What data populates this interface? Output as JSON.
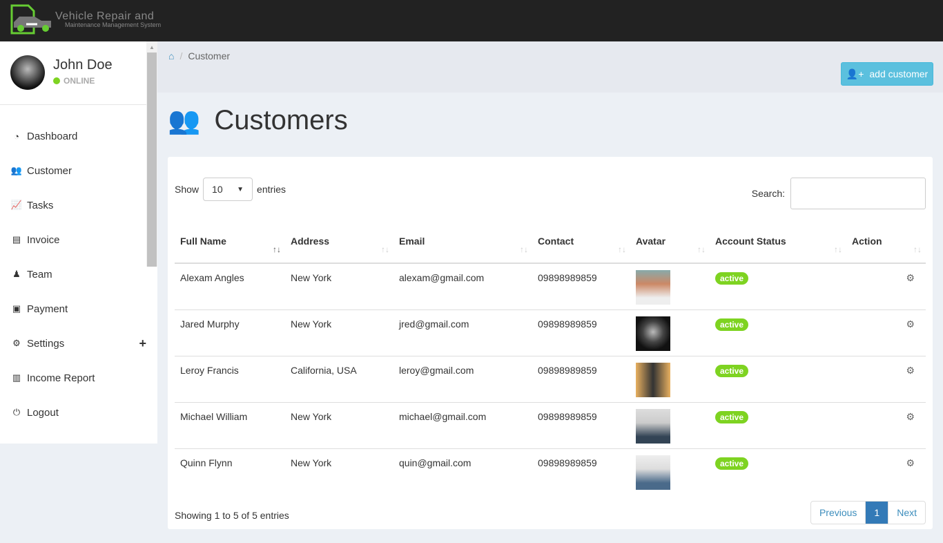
{
  "app": {
    "logo_line1": "Vehicle Repair and",
    "logo_line2": "Maintenance Management System"
  },
  "user": {
    "name": "John Doe",
    "status": "ONLINE"
  },
  "nav": [
    {
      "label": "Dashboard",
      "icon": "dashboard-icon",
      "glyph": "◔"
    },
    {
      "label": "Customer",
      "icon": "users-icon",
      "glyph": "👥"
    },
    {
      "label": "Tasks",
      "icon": "line-chart-icon",
      "glyph": "📈"
    },
    {
      "label": "Invoice",
      "icon": "file-icon",
      "glyph": "▤"
    },
    {
      "label": "Team",
      "icon": "user-secret-icon",
      "glyph": "♟"
    },
    {
      "label": "Payment",
      "icon": "money-icon",
      "glyph": "▣"
    },
    {
      "label": "Settings",
      "icon": "gears-icon",
      "glyph": "⚙"
    },
    {
      "label": "Income Report",
      "icon": "bar-chart-icon",
      "glyph": "▥"
    },
    {
      "label": "Logout",
      "icon": "power-icon",
      "glyph": "⏻"
    }
  ],
  "breadcrumb": {
    "current": "Customer"
  },
  "add_button": "add customer",
  "page_title": "Customers",
  "table_controls": {
    "show": "Show",
    "entries_value": "10",
    "entries": "entries",
    "search_label": "Search:",
    "search_value": ""
  },
  "columns": [
    "Full Name",
    "Address",
    "Email",
    "Contact",
    "Avatar",
    "Account Status",
    "Action"
  ],
  "rows": [
    {
      "name": "Alexam Angles",
      "address": "New York",
      "email": "alexam@gmail.com",
      "contact": "09898989859",
      "status": "active"
    },
    {
      "name": "Jared Murphy",
      "address": "New York",
      "email": "jred@gmail.com",
      "contact": "09898989859",
      "status": "active"
    },
    {
      "name": "Leroy Francis",
      "address": "California, USA",
      "email": "leroy@gmail.com",
      "contact": "09898989859",
      "status": "active"
    },
    {
      "name": "Michael William",
      "address": "New York",
      "email": "michael@gmail.com",
      "contact": "09898989859",
      "status": "active"
    },
    {
      "name": "Quinn Flynn",
      "address": "New York",
      "email": "quin@gmail.com",
      "contact": "09898989859",
      "status": "active"
    }
  ],
  "footer": {
    "info": "Showing 1 to 5 of 5 entries",
    "prev": "Previous",
    "page": "1",
    "next": "Next"
  },
  "colors": {
    "accent": "#3c8dbc",
    "active": "#7ed321",
    "add_button": "#5bc0de"
  }
}
